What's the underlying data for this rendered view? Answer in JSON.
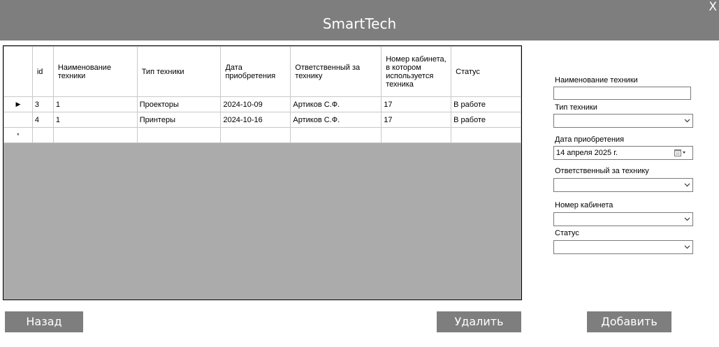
{
  "window": {
    "title": "SmartTech",
    "close_label": "X"
  },
  "table": {
    "columns": [
      "",
      "id",
      "Наименование техники",
      "Тип техники",
      "Дата приобретения",
      "Ответственный за технику",
      "Номер кабинета, в котором используется техника",
      "Статус"
    ],
    "rows": [
      {
        "marker": "▶",
        "cells": [
          "3",
          "1",
          "Проекторы",
          "2024-10-09",
          "Артиков С.Ф.",
          "17",
          "В работе"
        ]
      },
      {
        "marker": "",
        "cells": [
          "4",
          "1",
          "Принтеры",
          "2024-10-16",
          "Артиков С.Ф.",
          "17",
          "В работе"
        ]
      }
    ],
    "new_row_marker": "*"
  },
  "form": {
    "name_label": "Наименование техники",
    "name_value": "",
    "type_label": "Тип техники",
    "type_value": "",
    "date_label": "Дата приобретения",
    "date_value": "14  апреля   2025 г.",
    "responsible_label": "Ответственный за технику",
    "responsible_value": "",
    "room_label": "Номер кабинета",
    "room_value": "",
    "status_label": "Статус",
    "status_value": ""
  },
  "buttons": {
    "back": "Назад",
    "delete": "Удалить",
    "add": "Добавить"
  },
  "icons": {
    "close": "close-icon",
    "row_pointer": "row-pointer-icon",
    "dropdown": "chevron-down-icon",
    "calendar": "calendar-icon"
  },
  "colors": {
    "titlebar": "#7e7e7e",
    "button": "#7e7e7e",
    "grid_background": "#ababab"
  }
}
